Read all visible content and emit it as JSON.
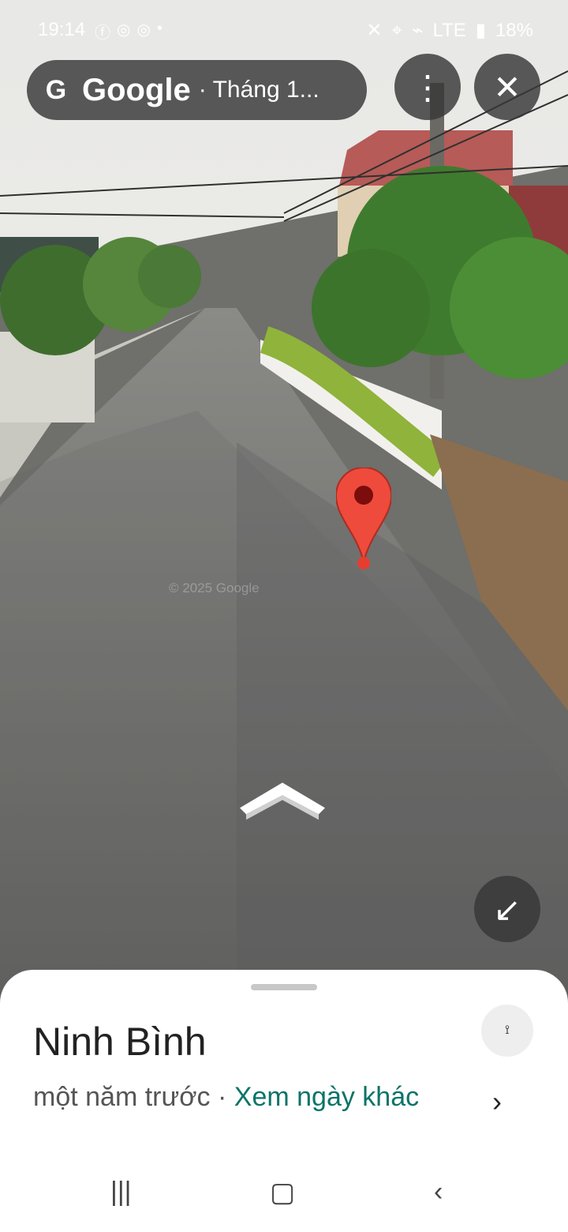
{
  "status": {
    "time": "19:14",
    "battery": "18%",
    "network": "LTE"
  },
  "toolbar": {
    "brand": "Google",
    "subtitle": "· Tháng 1..."
  },
  "scene": {
    "watermark": "© 2025 Google"
  },
  "sheet": {
    "place": "Ninh Bình",
    "when": "một năm trước",
    "separator": "·",
    "link": "Xem ngày khác"
  }
}
